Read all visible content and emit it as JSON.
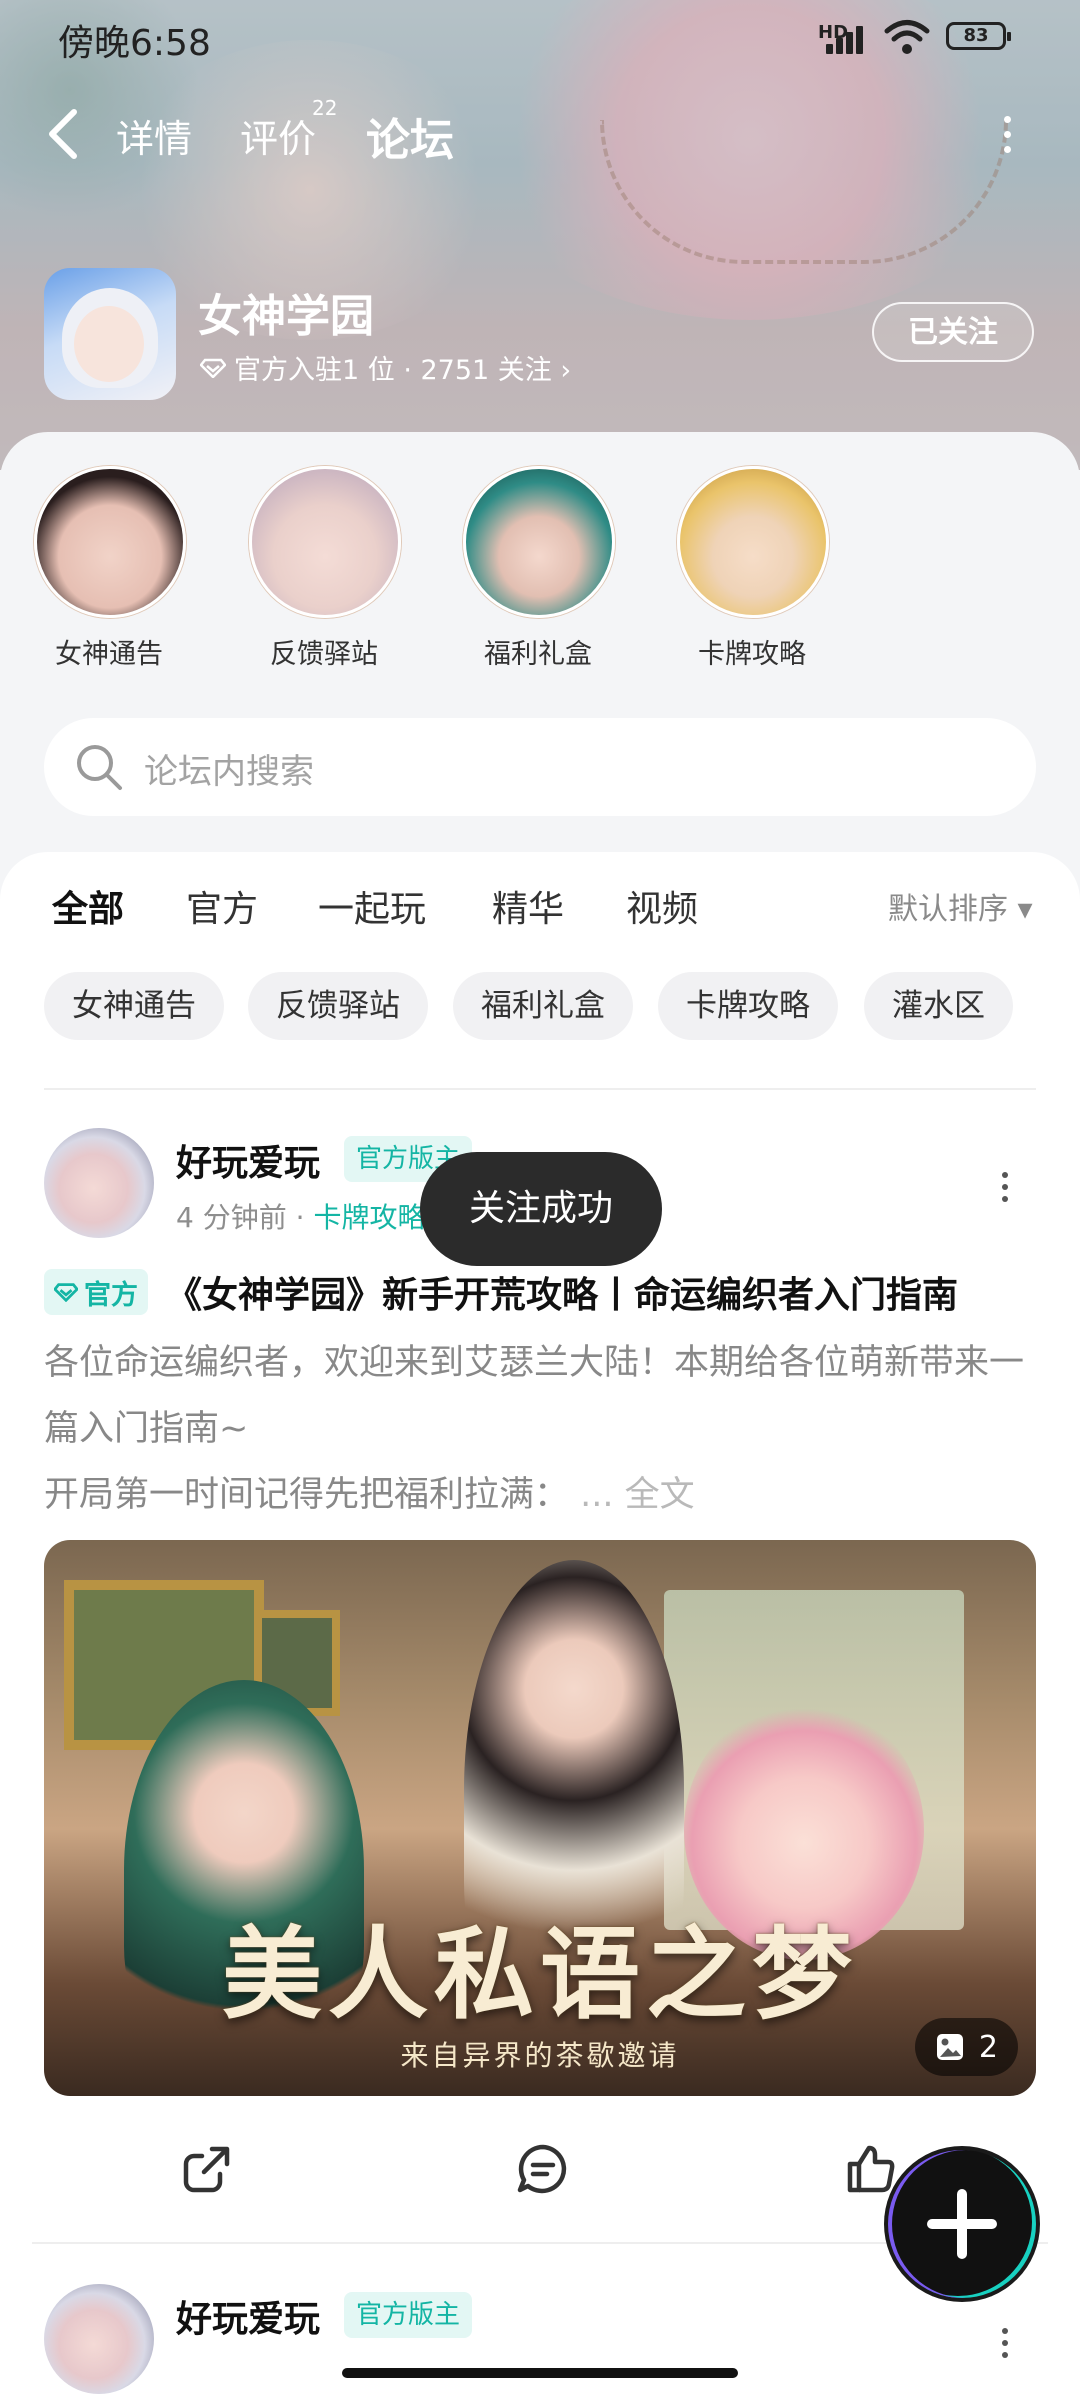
{
  "status_bar": {
    "time": "傍晚6:58",
    "network": "HD",
    "battery": "83"
  },
  "nav": {
    "tabs": [
      {
        "label": "详情"
      },
      {
        "label": "评价",
        "badge": "22"
      },
      {
        "label": "论坛"
      }
    ],
    "active_tab": "论坛"
  },
  "game": {
    "title": "女神学园",
    "subtitle": "官方入驻1 位 · 2751 关注 ›",
    "follow_label": "已关注"
  },
  "categories": [
    {
      "label": "女神通告"
    },
    {
      "label": "反馈驿站"
    },
    {
      "label": "福利礼盒"
    },
    {
      "label": "卡牌攻略"
    }
  ],
  "search": {
    "placeholder": "论坛内搜索"
  },
  "filter_tabs": [
    "全部",
    "官方",
    "一起玩",
    "精华",
    "视频"
  ],
  "sort_label": "默认排序 ▾",
  "chips": [
    "女神通告",
    "反馈驿站",
    "福利礼盒",
    "卡牌攻略",
    "灌水区"
  ],
  "posts": [
    {
      "author": "好玩爱玩",
      "role": "官方版主",
      "time": "4 分钟前",
      "tag": "卡牌攻略",
      "badge": "官方",
      "title": "《女神学园》新手开荒攻略丨命运编织者入门指南",
      "excerpt_1": "各位命运编织者，欢迎来到艾瑟兰大陆！本期给各位萌新带来一篇入门指南~",
      "excerpt_2": "开局第一时间记得先把福利拉满：",
      "fulltext_label": "... 全文",
      "image_title": "美人私语之梦",
      "image_subtitle": "来自异界的茶歇邀请",
      "image_count": "2"
    },
    {
      "author": "好玩爱玩",
      "role": "官方版主"
    }
  ],
  "toast": "关注成功",
  "colors": {
    "accent": "#14c6b5",
    "accent_text": "#14b5a4"
  }
}
